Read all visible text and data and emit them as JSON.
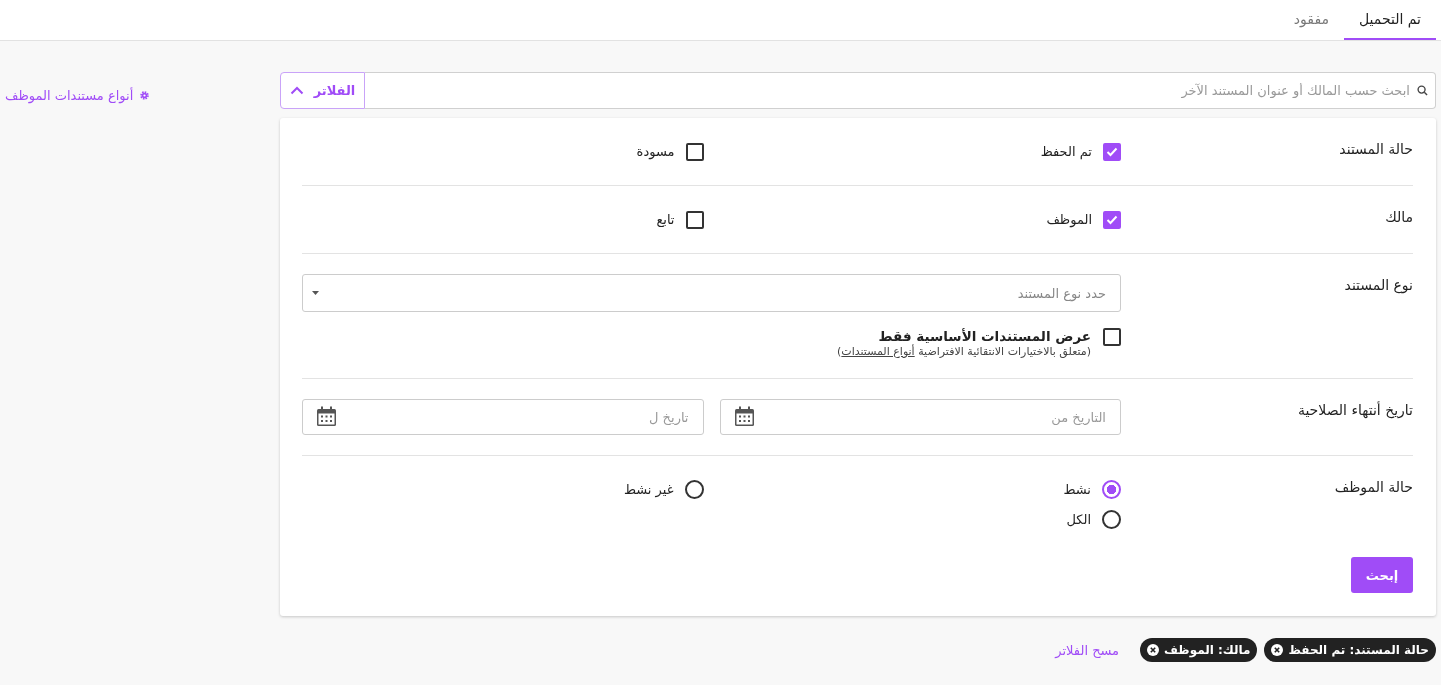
{
  "tabs": [
    {
      "label": "تم التحميل",
      "selected": true
    },
    {
      "label": "مفقود",
      "selected": false
    }
  ],
  "search": {
    "placeholder": "ابحث حسب المالك أو عنوان المستند الآخر"
  },
  "filter_toggle": {
    "label": "الفلاتر",
    "expanded": true
  },
  "document_types_link": "أنواع مستندات الموظف",
  "filters": [
    {
      "label": "حالة المستند",
      "kind": "checkbox",
      "options": [
        {
          "label": "تم الحفظ",
          "checked": true
        },
        {
          "label": "مسودة",
          "checked": false
        }
      ]
    },
    {
      "label": "مالك",
      "kind": "checkbox",
      "options": [
        {
          "label": "الموظف",
          "checked": true
        },
        {
          "label": "تابع",
          "checked": false
        }
      ]
    },
    {
      "label": "نوع المستند",
      "kind": "select",
      "placeholder": "حدد نوع المستند",
      "extra": {
        "label": "عرض المستندات الأساسية فقط",
        "checked": false,
        "note": "(متعلق بالاختيارات الانتقائية الافتراضية",
        "note_link": "أنواع المستندات",
        "note_end": ")"
      }
    },
    {
      "label": "تاريخ أنتهاء الصلاحية",
      "kind": "date",
      "fields": [
        {
          "placeholder": "التاريخ من"
        },
        {
          "placeholder": "تاريخ ل"
        }
      ]
    },
    {
      "label": "حالة الموظف",
      "kind": "radio",
      "options": [
        {
          "label": "نشط",
          "selected": true
        },
        {
          "label": "غير نشط",
          "selected": false
        },
        {
          "label": "الكل",
          "selected": false
        }
      ]
    }
  ],
  "search_button": "إبحث",
  "chips": [
    {
      "label": "حالة المستند: تم الحفظ"
    },
    {
      "label": "مالك: الموظف"
    }
  ],
  "clear_filters": "مسح الفلاتر"
}
